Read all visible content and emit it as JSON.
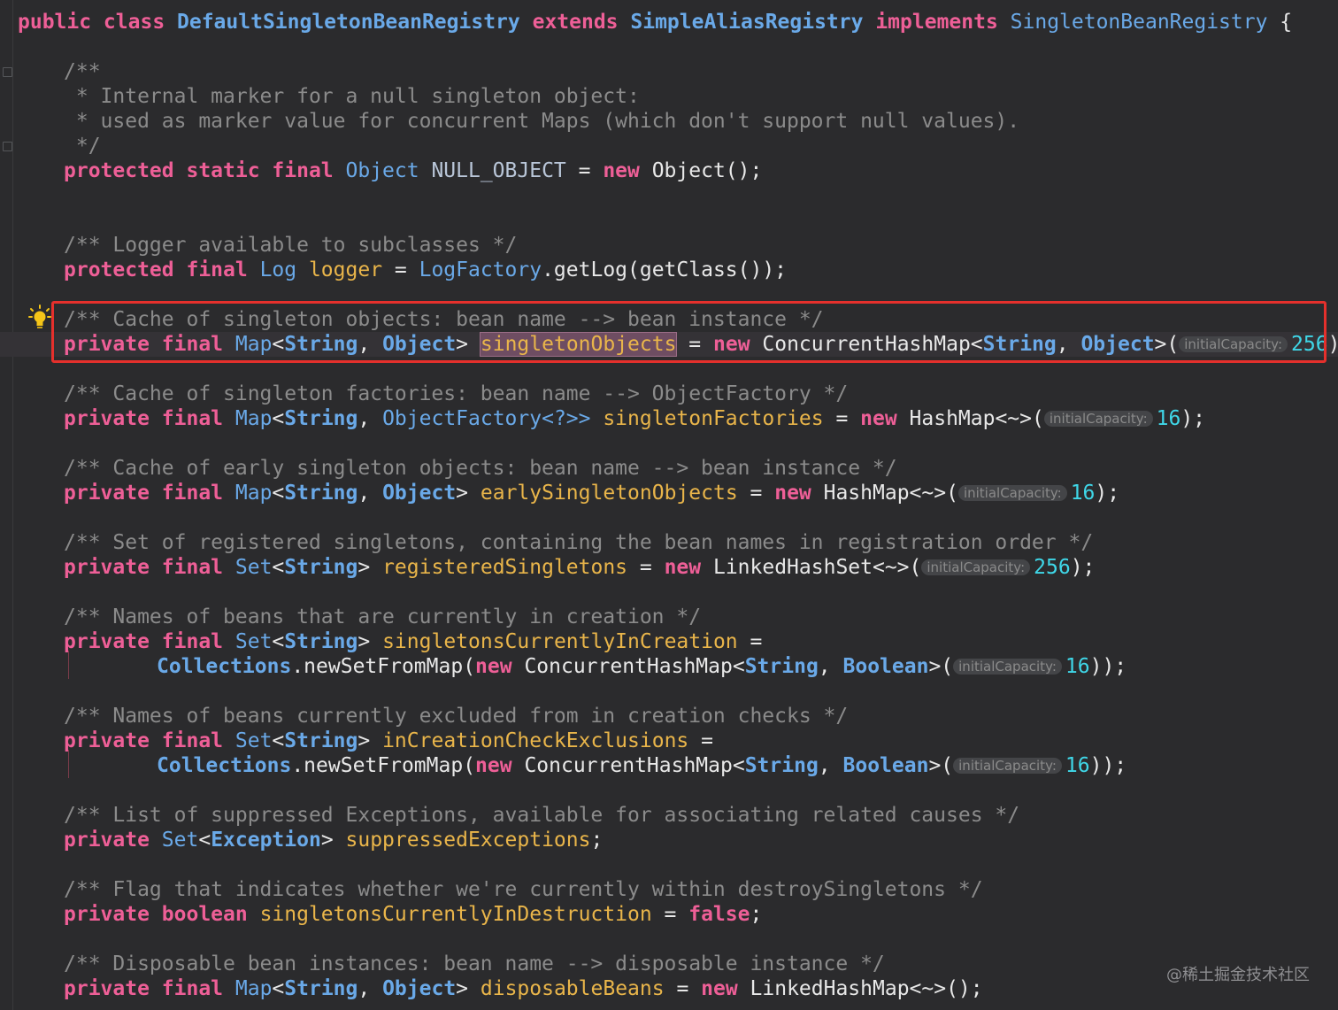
{
  "code": {
    "l0": {
      "kw1": "public class ",
      "cls": "DefaultSingletonBeanRegistry",
      "kw2": " extends ",
      "parent": "SimpleAliasRegistry",
      "kw3": " implements ",
      "iface": "SingletonBeanRegistry",
      "tail": " {"
    },
    "l1": "/**",
    "l2": " * Internal marker for a null singleton object:",
    "l3": " * used as marker value for concurrent Maps (which don't support null values).",
    "l4": " */",
    "l5": {
      "kw": "protected static final ",
      "type": "Object",
      "name": " NULL_OBJECT",
      "eq": " = ",
      "new": "new",
      "rest": " Object();"
    },
    "l6": "/** Logger available to subclasses */",
    "l7": {
      "kw": "protected final ",
      "type": "Log",
      "name": " logger",
      "eq": " = ",
      "cls": "LogFactory",
      "rest": ".getLog(getClass());"
    },
    "l8": "/** Cache of singleton objects: bean name --> bean instance */",
    "l9": {
      "kw": "private final ",
      "map": "Map",
      "lt": "<",
      "s": "String",
      "c": ", ",
      "o": "Object",
      "gt": ">",
      "name": "singletonObjects",
      "eq": " = ",
      "new": "new",
      "rest": " ConcurrentHashMap<",
      "s2": "String",
      "c2": ", ",
      "o2": "Object",
      "gt2": ">(",
      "hint": "initialCapacity:",
      "num": "256",
      "end": ");"
    },
    "l10": "/** Cache of singleton factories: bean name --> ObjectFactory */",
    "l11": {
      "kw": "private final ",
      "map": "Map",
      "lt": "<",
      "s": "String",
      "c": ", ",
      "of": "ObjectFactory<?>>",
      "name": " singletonFactories",
      "eq": " = ",
      "new": "new",
      "rest": " HashMap<~>(",
      "hint": "initialCapacity:",
      "num": "16",
      "end": ");"
    },
    "l12": "/** Cache of early singleton objects: bean name --> bean instance */",
    "l13": {
      "kw": "private final ",
      "map": "Map",
      "lt": "<",
      "s": "String",
      "c": ", ",
      "o": "Object",
      "gt": ">",
      "name": " earlySingletonObjects",
      "eq": " = ",
      "new": "new",
      "rest": " HashMap<~>(",
      "hint": "initialCapacity:",
      "num": "16",
      "end": ");"
    },
    "l14": "/** Set of registered singletons, containing the bean names in registration order */",
    "l15": {
      "kw": "private final ",
      "set": "Set",
      "lt": "<",
      "s": "String",
      "gt": ">",
      "name": " registeredSingletons",
      "eq": " = ",
      "new": "new",
      "rest": " LinkedHashSet<~>(",
      "hint": "initialCapacity:",
      "num": "256",
      "end": ");"
    },
    "l16": "/** Names of beans that are currently in creation */",
    "l17": {
      "kw": "private final ",
      "set": "Set",
      "lt": "<",
      "s": "String",
      "gt": ">",
      "name": " singletonsCurrentlyInCreation",
      "eq": " ="
    },
    "l18": {
      "col": "Collections",
      "m": ".newSetFromMap(",
      "new": "new",
      "rest": " ConcurrentHashMap<",
      "s": "String",
      "c": ", ",
      "b": "Boolean",
      "gt": ">(",
      "hint": "initialCapacity:",
      "num": "16",
      "end": "));"
    },
    "l19": "/** Names of beans currently excluded from in creation checks */",
    "l20": {
      "kw": "private final ",
      "set": "Set",
      "lt": "<",
      "s": "String",
      "gt": ">",
      "name": " inCreationCheckExclusions",
      "eq": " ="
    },
    "l21": {
      "col": "Collections",
      "m": ".newSetFromMap(",
      "new": "new",
      "rest": " ConcurrentHashMap<",
      "s": "String",
      "c": ", ",
      "b": "Boolean",
      "gt": ">(",
      "hint": "initialCapacity:",
      "num": "16",
      "end": "));"
    },
    "l22": "/** List of suppressed Exceptions, available for associating related causes */",
    "l23": {
      "kw": "private ",
      "set": "Set",
      "lt": "<",
      "e": "Exception",
      "gt": ">",
      "name": " suppressedExceptions",
      "end": ";"
    },
    "l24": "/** Flag that indicates whether we're currently within destroySingletons */",
    "l25": {
      "kw": "private boolean ",
      "name": "singletonsCurrentlyInDestruction",
      "eq": " = ",
      "val": "false",
      "end": ";"
    },
    "l26": "/** Disposable bean instances: bean name --> disposable instance */",
    "l27": {
      "kw": "private final ",
      "map": "Map",
      "lt": "<",
      "s": "String",
      "c": ", ",
      "o": "Object",
      "gt": ">",
      "name": " disposableBeans",
      "eq": " = ",
      "new": "new",
      "rest": " LinkedHashMap<~>();"
    }
  },
  "watermark": "@稀土掘金技术社区",
  "colors": {
    "keyword": "#ee5f97",
    "type": "#6aa9e8",
    "field": "#e9b54a",
    "comment": "#8b8b8b",
    "number": "#3fd7e8",
    "highlight_box": "#e5302c"
  },
  "icons": {
    "intention": "lightbulb-icon"
  }
}
